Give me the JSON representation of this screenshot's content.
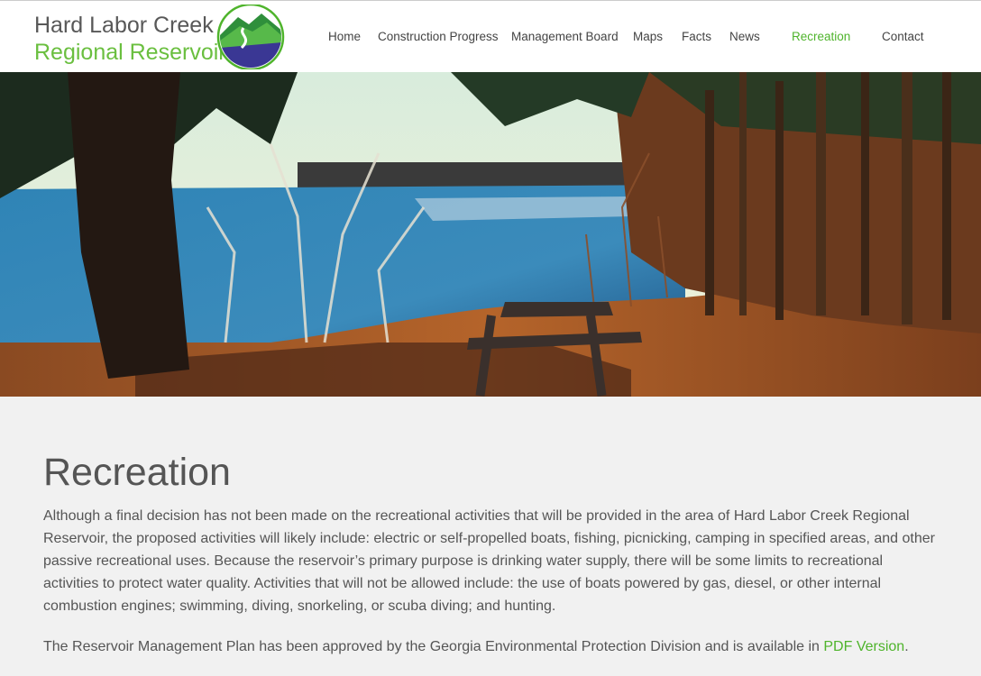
{
  "site": {
    "brand_line1": "Hard Labor Creek",
    "brand_line2": "Regional Reservoir"
  },
  "nav": {
    "items": [
      {
        "label": "Home"
      },
      {
        "label": "Construction Progress"
      },
      {
        "label": "Management Board"
      },
      {
        "label": "Maps"
      },
      {
        "label": "Facts"
      },
      {
        "label": "News"
      },
      {
        "label": "Recreation",
        "active": true
      },
      {
        "label": "Contact"
      }
    ]
  },
  "main": {
    "title": "Recreation",
    "paragraph1": "Although a final decision has not been made on the recreational activities that will be provided in the area of Hard Labor Creek Regional Reservoir, the proposed activities will likely include: electric or self-propelled boats, fishing, picnicking, camping in specified areas, and other passive recreational uses. Because the reservoir’s primary purpose is drinking water supply, there will be some limits to recreational activities to protect water quality. Activities that will not be allowed include: the use of boats powered by gas, diesel, or other internal combustion engines; swimming, diving, snorkeling, or scuba diving; and hunting.",
    "paragraph2_text": "The Reservoir Management Plan has been approved by the Georgia Environmental Protection Division and is available in ",
    "paragraph2_link": "PDF Version",
    "paragraph2_end": "."
  },
  "colors": {
    "accent_green": "#4fb42c",
    "text_gray": "#555555",
    "background": "#f1f1f1"
  }
}
